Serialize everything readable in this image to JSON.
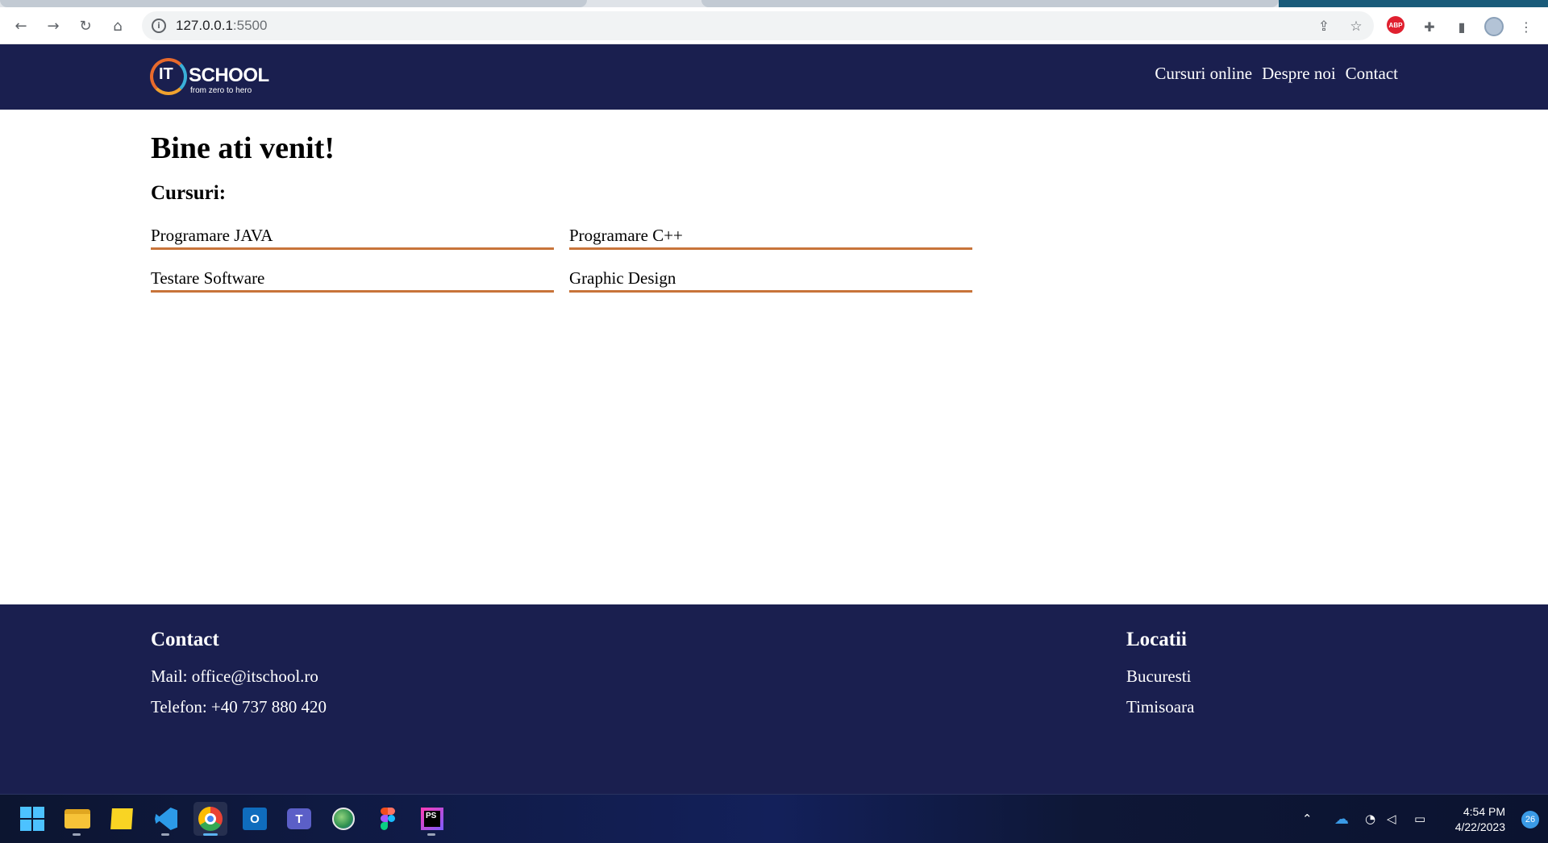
{
  "browser": {
    "url_host": "127.0.0.1",
    "url_port": ":5500",
    "extensions": [
      "ABP"
    ]
  },
  "site": {
    "logo": {
      "it": "IT",
      "school": "SCHOOL",
      "tagline": "from zero to hero"
    },
    "nav": [
      {
        "label": "Cursuri online"
      },
      {
        "label": "Despre noi"
      },
      {
        "label": "Contact"
      }
    ]
  },
  "main": {
    "title": "Bine ati venit!",
    "courses_heading": "Cursuri:",
    "courses": [
      {
        "label": "Programare JAVA"
      },
      {
        "label": "Programare C++"
      },
      {
        "label": "Testare Software"
      },
      {
        "label": "Graphic Design"
      }
    ]
  },
  "footer": {
    "contact": {
      "heading": "Contact",
      "mail": "Mail: office@itschool.ro",
      "phone": "Telefon: +40 737 880 420"
    },
    "locations": {
      "heading": "Locatii",
      "items": [
        {
          "label": "Bucuresti"
        },
        {
          "label": "Timisoara"
        }
      ]
    }
  },
  "taskbar": {
    "time": "4:54 PM",
    "date": "4/22/2023",
    "notifications": "26",
    "apps": [
      "windows-start",
      "file-explorer",
      "sticky-notes",
      "vscode",
      "chrome",
      "outlook",
      "teams",
      "globe-app",
      "figma",
      "phpstorm"
    ]
  },
  "colors": {
    "header_bg": "#1a1f4f",
    "accent_underline": "#c8743a"
  }
}
